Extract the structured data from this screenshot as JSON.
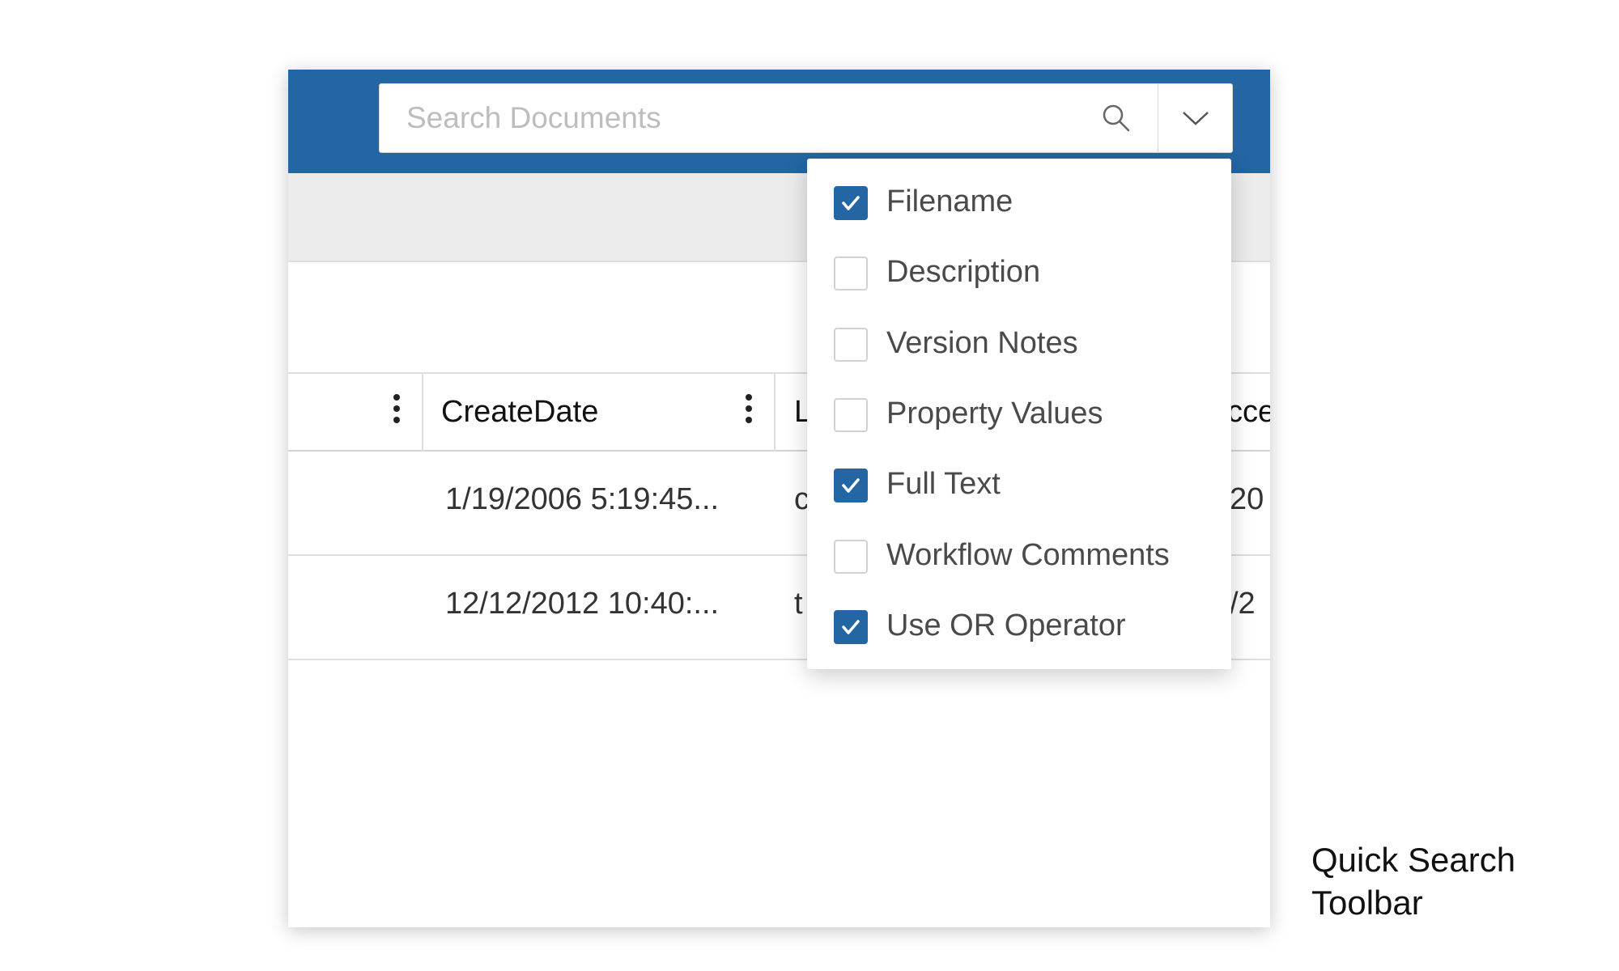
{
  "search": {
    "placeholder": "Search Documents",
    "value": ""
  },
  "colors": {
    "header": "#2366a3",
    "checkbox_checked": "#2366a3",
    "band": "#ececed"
  },
  "table": {
    "columns": [
      "",
      "CreateDate",
      "L",
      "cce"
    ],
    "rows": [
      {
        "create_date": "1/19/2006 5:19:45...",
        "col3": "c",
        "col4": "20"
      },
      {
        "create_date": "12/12/2012 10:40:...",
        "col3": "t",
        "col4": "/2"
      }
    ]
  },
  "menu": {
    "items": [
      {
        "label": "Filename",
        "checked": true
      },
      {
        "label": "Description",
        "checked": false
      },
      {
        "label": "Version Notes",
        "checked": false
      },
      {
        "label": "Property Values",
        "checked": false
      },
      {
        "label": "Full Text",
        "checked": true
      },
      {
        "label": "Workflow Comments",
        "checked": false
      },
      {
        "label": "Use OR Operator",
        "checked": true
      }
    ]
  },
  "caption": {
    "line1": "Quick Search",
    "line2": "Toolbar"
  }
}
